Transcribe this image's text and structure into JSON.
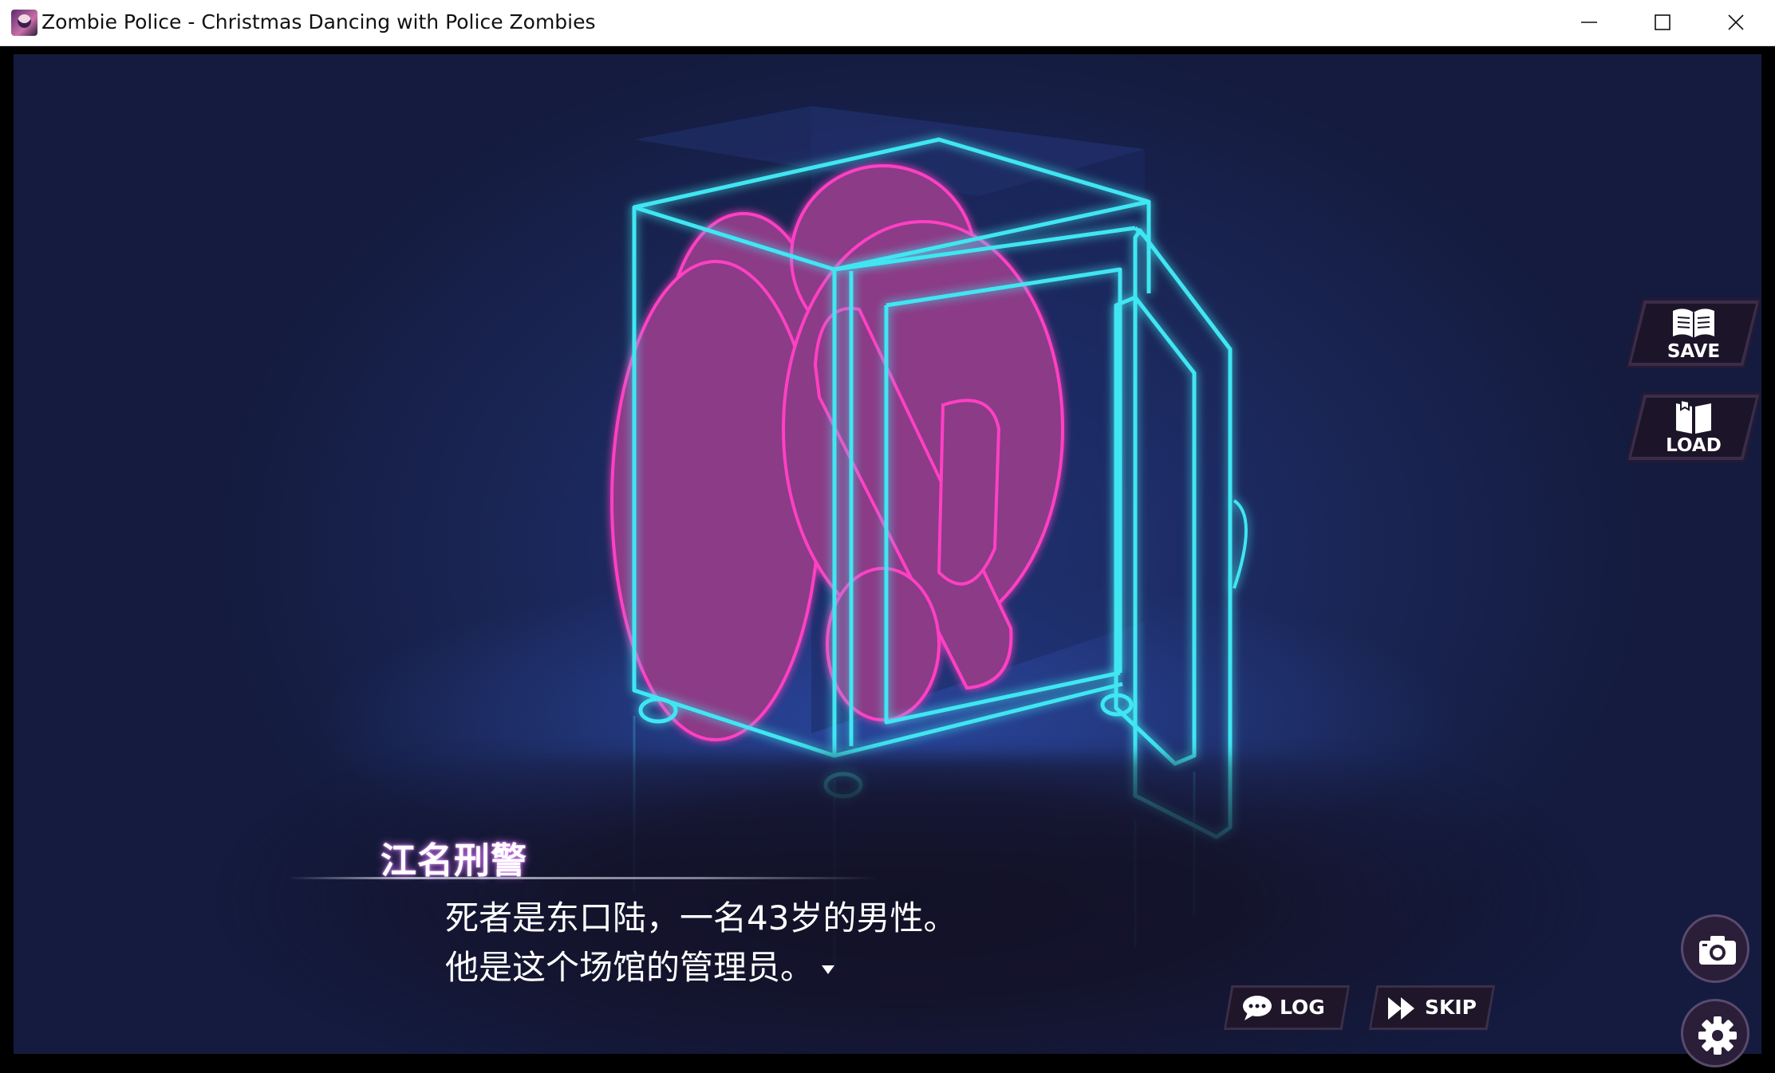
{
  "window": {
    "title": "Zombie Police - Christmas Dancing with Police Zombies",
    "app_icon": "game-app-icon",
    "controls": [
      "minimize-icon",
      "maximize-icon",
      "close-icon"
    ]
  },
  "scene": {
    "description_icons": [
      "neon-safe-icon",
      "crouched-body-icon"
    ],
    "colors": {
      "neon_cyan": "#3fe6f2",
      "neon_pink": "#ff3fc4",
      "body_fill": "#8c3a86",
      "background": "#1d2c66"
    }
  },
  "dialogue": {
    "speaker": "江名刑警",
    "line1": "死者是东口陆，一名43岁的男性。",
    "line2": "他是这个场馆的管理员。"
  },
  "controls": {
    "save_label": "SAVE",
    "load_label": "LOAD",
    "log_label": "LOG",
    "skip_label": "SKIP"
  }
}
